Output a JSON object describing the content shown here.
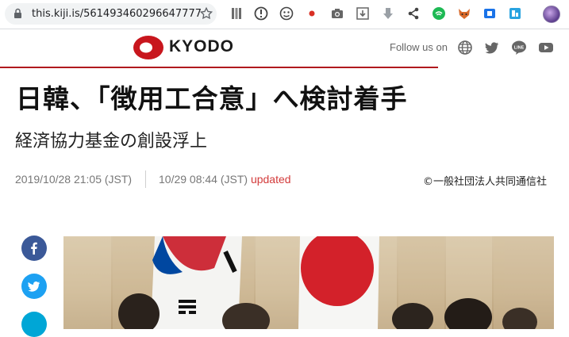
{
  "browser": {
    "url": "this.kiji.is/561493460296647777",
    "extensions": [
      "library-icon",
      "alert-icon",
      "face-icon",
      "record-icon",
      "camera-icon",
      "download-icon",
      "arrow-down-icon",
      "share-icon",
      "cast-icon",
      "fox-icon",
      "square-icon",
      "badge-icon"
    ]
  },
  "site": {
    "brand": "KYODO",
    "follow_label": "Follow us on",
    "accent_color": "#b0191e"
  },
  "article": {
    "headline": "日韓、「徴用工合意」へ検討着手",
    "subhead": "経済協力基金の創設浮上",
    "published": "2019/10/28 21:05 (JST)",
    "updated_time": "10/29 08:44 (JST)",
    "updated_label": "updated",
    "credit": "©一般社団法人共同通信社"
  }
}
